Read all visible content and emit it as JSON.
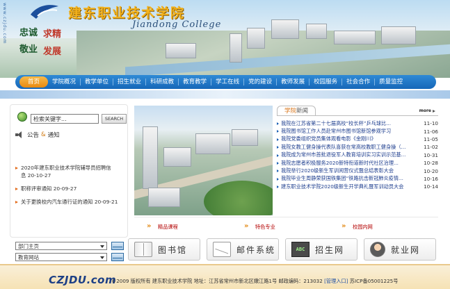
{
  "banner": {
    "side_url": "www.czjdu.com",
    "title_cn": "建东职业技术学院",
    "title_en": "Jiandong College",
    "motto": [
      "忠诚",
      "敬业",
      "求精",
      "发展"
    ]
  },
  "nav": {
    "items": [
      "首页",
      "学院概况",
      "教学单位",
      "招生就业",
      "科研成教",
      "教育教学",
      "学工在线",
      "党的建设",
      "教师发展",
      "校园服务",
      "社会合作",
      "质量监控"
    ]
  },
  "search": {
    "placeholder": "检索关键字",
    "value": "检索关键字...",
    "button_label": "SEARCH"
  },
  "notice": {
    "head_a": "公告",
    "amp": "&",
    "head_b": "通知",
    "items": [
      {
        "title": "2020年建东职业技术学院辅导员招聘信",
        "date": "息 20-10-27"
      },
      {
        "title": "职称评审通知",
        "date": "20-09-27"
      },
      {
        "title": "关于更换校内汽车通行证的通知",
        "date": "20-09-21"
      }
    ]
  },
  "news": {
    "tab_a": "学院",
    "tab_b": "新闻",
    "more_label": "more",
    "items": [
      {
        "title": "我院在江苏省第二十七届高校“校长杯”乒乓球比...",
        "date": "11-10"
      },
      {
        "title": "我院图书馆工作人员赴常州市图书馆新馆参观学习",
        "date": "11-06"
      },
      {
        "title": "我院党委组织党员集体观看电影《金刚川》",
        "date": "11-05"
      },
      {
        "title": "我院女教工健身操代表队喜获在常高校教职工健身操（...",
        "date": "11-02"
      },
      {
        "title": "我院成为常州市首批退役军人教育培训实习实训示范基...",
        "date": "10-31"
      },
      {
        "title": "我院志愿者积极服务2020新特衔道新时代社区治理...",
        "date": "10-28"
      },
      {
        "title": "我院举行2020级新生军训阅营仪式暨总结表彰大会",
        "date": "10-20"
      },
      {
        "title": "我院毕业生周静荣获国铁集团“铁路抗击新冠肺炎疫情...",
        "date": "10-16"
      },
      {
        "title": "建东职业技术学院2020级新生开学典礼暨军训动员大会",
        "date": "10-14"
      }
    ]
  },
  "featured": [
    "精品课程",
    "特色专业",
    "校园内网"
  ],
  "selects": [
    {
      "label": "部门主页"
    },
    {
      "label": "教育网站"
    }
  ],
  "quick_links": [
    {
      "label": "图书馆",
      "icon": "book-icon"
    },
    {
      "label": "邮件系统",
      "icon": "envelope-icon"
    },
    {
      "label": "招生网",
      "icon": "abc-icon",
      "icon_text": "ABC"
    },
    {
      "label": "就业网",
      "icon": "person-icon"
    }
  ],
  "footer": {
    "logo": "CZJDU.com",
    "copyright": "©2009 版权所有 建东职业技术学院 地址：江苏省常州市新北区嫩江路1号 邮政编码：213032",
    "admin_label": "[管理入口]",
    "icp": "苏ICP备05001225号"
  },
  "colors": {
    "nav_blue": "#1667b8",
    "nav_home_orange": "#e98a10",
    "title_gold": "#f3b21c",
    "news_link": "#1f3f8f",
    "featured_red": "#b30000",
    "footer_bg": "#f6e2b4"
  }
}
